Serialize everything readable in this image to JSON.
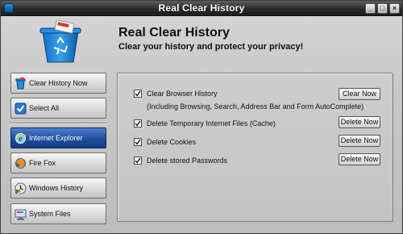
{
  "window": {
    "title": "Real Clear History"
  },
  "header": {
    "app_name": "Real Clear History",
    "tagline": "Clear your history and protect your privacy!"
  },
  "sidebar": {
    "actions": [
      {
        "label": "Clear History Now",
        "icon": "trash-icon"
      },
      {
        "label": "Select All",
        "icon": "checkbox-icon"
      }
    ],
    "sources": [
      {
        "label": "Internet Explorer",
        "icon": "internet-explorer-icon",
        "active": true
      },
      {
        "label": "Fire Fox",
        "icon": "firefox-icon",
        "active": false
      },
      {
        "label": "Windows History",
        "icon": "windows-history-icon",
        "active": false
      },
      {
        "label": "System Files",
        "icon": "system-files-icon",
        "active": false
      }
    ]
  },
  "options": [
    {
      "label": "Clear Browser History",
      "sub": "(Including Browsing, Search, Address Bar and Form AutoComplete)",
      "checked": true,
      "button": "Clear Now"
    },
    {
      "label": "Delete Temporary Internet Files (Cache)",
      "checked": true,
      "button": "Delete Now"
    },
    {
      "label": "Delete Cookies",
      "checked": true,
      "button": "Delete Now"
    },
    {
      "label": "Delete stored Passwords",
      "checked": true,
      "button": "Delete Now"
    }
  ],
  "colors": {
    "accent": "#1f4f9e",
    "titlebar": "#2b2b2b"
  }
}
